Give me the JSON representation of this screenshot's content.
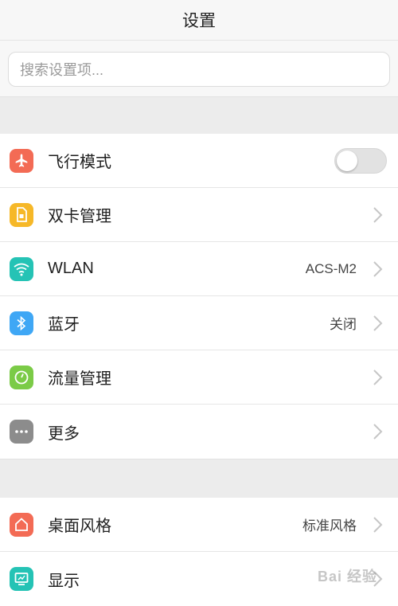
{
  "header": {
    "title": "设置"
  },
  "search": {
    "placeholder": "搜索设置项..."
  },
  "section1": [
    {
      "label": "飞行模式",
      "icon": "airplane-icon",
      "color": "#f36b55",
      "control": "toggle",
      "value": ""
    },
    {
      "label": "双卡管理",
      "icon": "sim-card-icon",
      "color": "#f6b828",
      "control": "chevron",
      "value": ""
    },
    {
      "label": "WLAN",
      "icon": "wifi-icon",
      "color": "#25c3b5",
      "control": "chevron",
      "value": "ACS-M2"
    },
    {
      "label": "蓝牙",
      "icon": "bluetooth-icon",
      "color": "#3fa7f5",
      "control": "chevron",
      "value": "关闭"
    },
    {
      "label": "流量管理",
      "icon": "data-usage-icon",
      "color": "#7bcb47",
      "control": "chevron",
      "value": ""
    },
    {
      "label": "更多",
      "icon": "more-icon",
      "color": "#8c8c8c",
      "control": "chevron",
      "value": ""
    }
  ],
  "section2": [
    {
      "label": "桌面风格",
      "icon": "home-icon",
      "color": "#f36b55",
      "control": "chevron",
      "value": "标准风格"
    },
    {
      "label": "显示",
      "icon": "display-icon",
      "color": "#25c3b5",
      "control": "chevron",
      "value": ""
    }
  ],
  "airplane_mode": {
    "on": false
  },
  "watermark": "Bai 经验"
}
